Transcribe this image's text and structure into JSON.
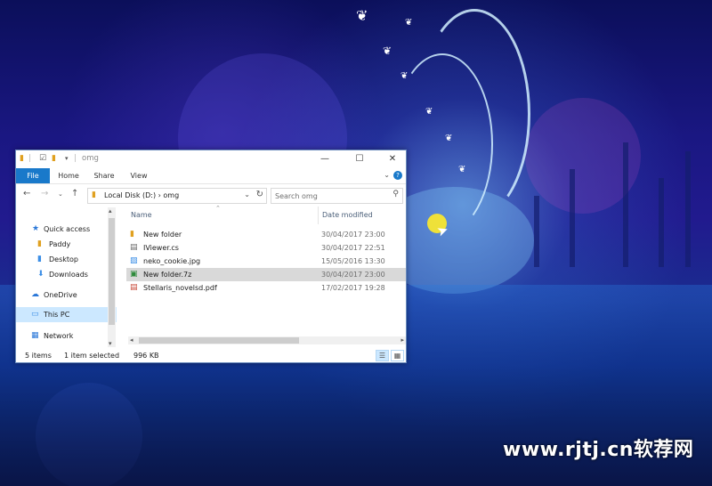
{
  "window": {
    "title": "omg",
    "controls": {
      "minimize": "—",
      "maximize": "☐",
      "close": "✕"
    }
  },
  "ribbon": {
    "tabs": [
      {
        "label": "File"
      },
      {
        "label": "Home"
      },
      {
        "label": "Share"
      },
      {
        "label": "View"
      }
    ],
    "help": "?",
    "active_color": "#1979ca"
  },
  "address": {
    "path": "Local Disk (D:)  ›  omg",
    "search_placeholder": "Search omg"
  },
  "nav": {
    "items": [
      {
        "label": "Quick access"
      },
      {
        "label": "Paddy"
      },
      {
        "label": "Desktop"
      },
      {
        "label": "Downloads"
      },
      {
        "label": "OneDrive"
      },
      {
        "label": "This PC"
      },
      {
        "label": "Network"
      }
    ]
  },
  "columns": {
    "name": "Name",
    "date": "Date modified"
  },
  "files": [
    {
      "name": "New folder",
      "date": "30/04/2017 23:00",
      "icon": "folder-icon"
    },
    {
      "name": "IViewer.cs",
      "date": "30/04/2017 22:51",
      "icon": "cs-file-icon"
    },
    {
      "name": "neko_cookie.jpg",
      "date": "15/05/2016 13:30",
      "icon": "image-file-icon"
    },
    {
      "name": "New folder.7z",
      "date": "30/04/2017 23:00",
      "icon": "archive-file-icon"
    },
    {
      "name": "Stellaris_novelsd.pdf",
      "date": "17/02/2017 19:28",
      "icon": "pdf-file-icon"
    }
  ],
  "status": {
    "count": "5 items",
    "selection": "1 item selected",
    "size": "996 KB"
  },
  "watermark": "www.rjtj.cn软荐网"
}
